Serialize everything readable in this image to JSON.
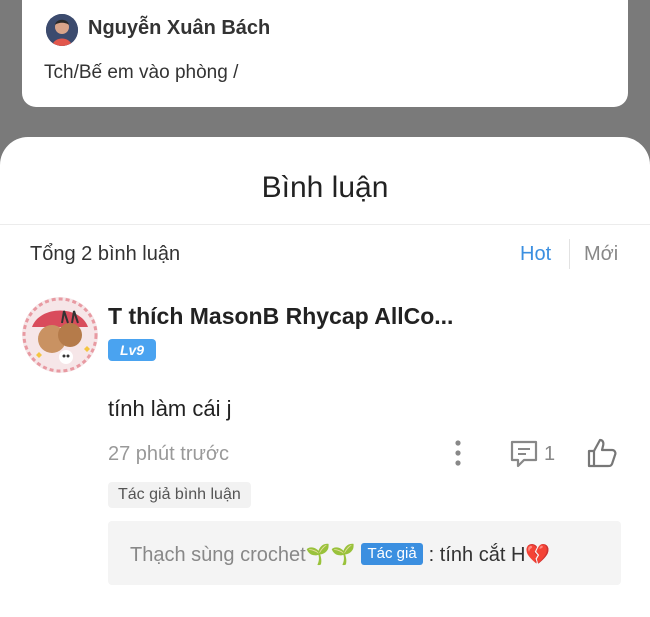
{
  "story": {
    "author_name": "Nguyễn Xuân Bách",
    "title": "Tch/Bế em vào phòng /"
  },
  "comments_panel": {
    "title": "Bình luận",
    "total": "Tổng 2 bình luận",
    "sort_hot": "Hot",
    "sort_new": "Mới",
    "active_sort": "Hot",
    "accent_color": "#3b8fe0"
  },
  "comment": {
    "user_name": "T thích MasonB Rhycap AllCo...",
    "level": "Lv9",
    "text": "tính làm cái j",
    "time": "27 phút trước",
    "reply_count": "1",
    "author_tag": "Tác giả bình luận",
    "reply": {
      "user": "Thạch sùng crochet🌱🌱",
      "badge": "Tác giả",
      "text": ": tính cắt H",
      "emoji": "💔"
    }
  },
  "icons": [
    "more-vertical-icon",
    "reply-icon",
    "like-icon"
  ]
}
